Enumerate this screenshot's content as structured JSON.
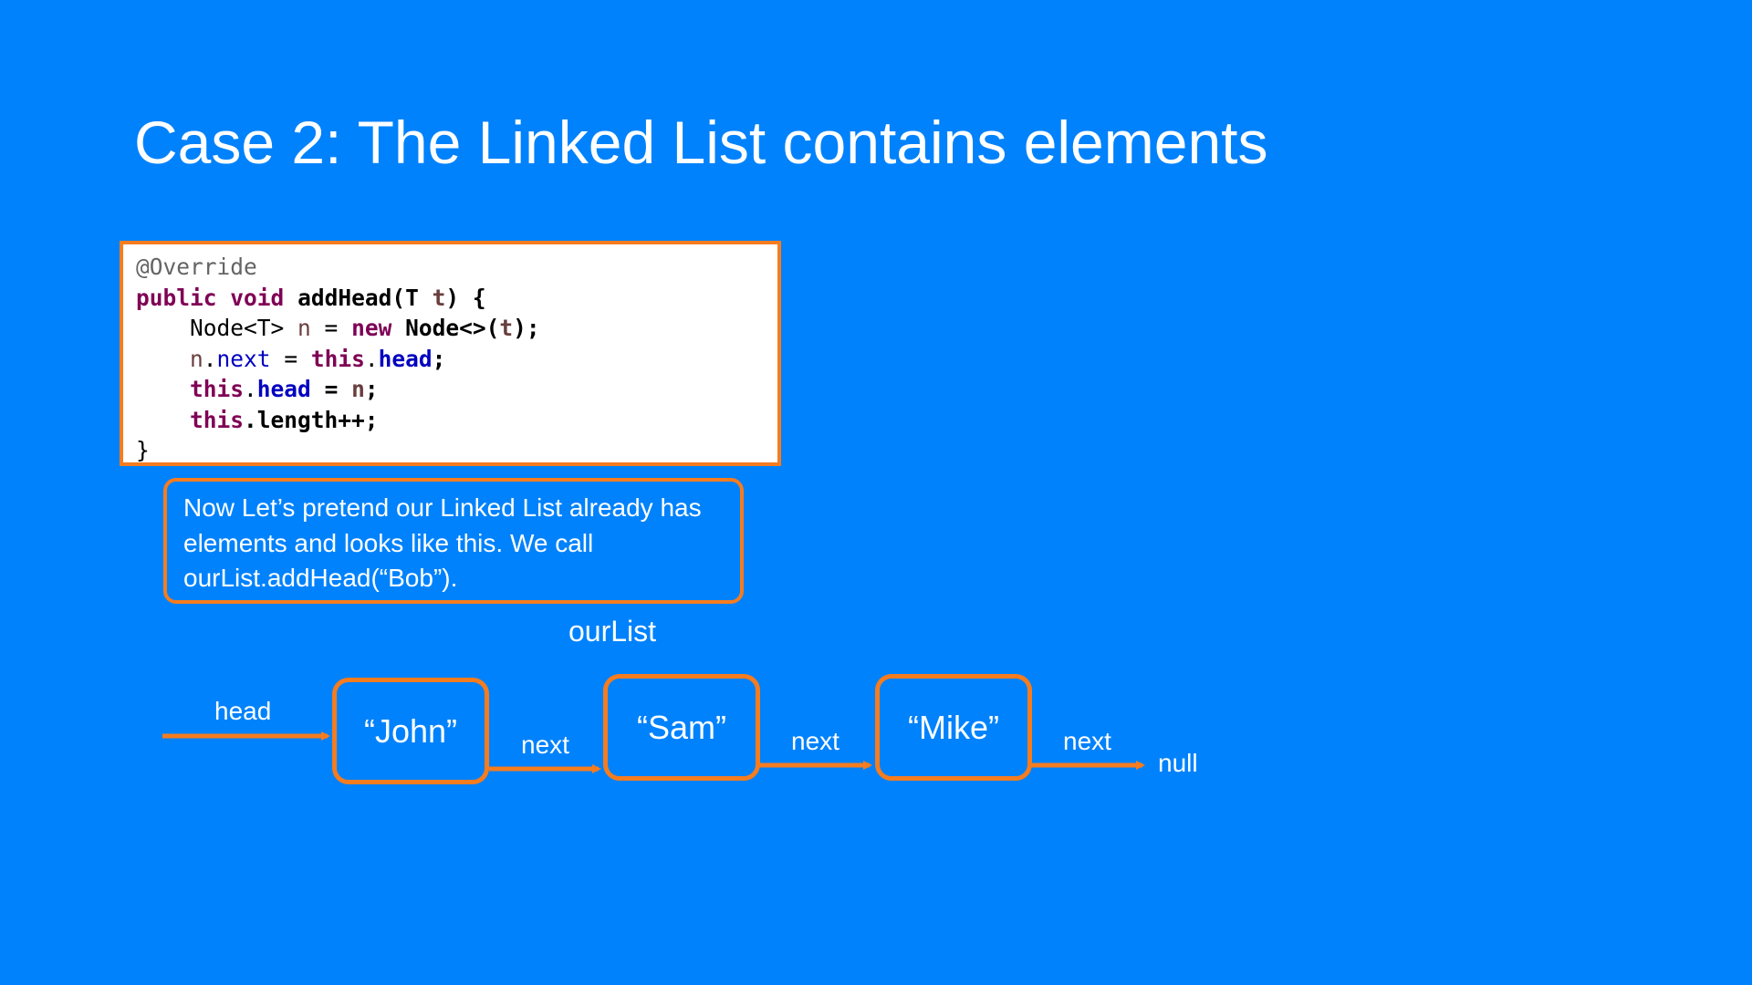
{
  "slide": {
    "title": "Case 2: The Linked List contains elements"
  },
  "code": {
    "annotation": "@Override",
    "kw_public": "public",
    "kw_void": "void",
    "method_sig": "addHead(T ",
    "param_t": "t",
    "sig_end": ") {",
    "l3_type": "Node<T> ",
    "l3_var": "n",
    "l3_eq": " = ",
    "kw_new": "new",
    "l3_ctor": " Node<>(",
    "l3_arg": "t",
    "l3_end": ");",
    "l4_var": "n",
    "l4_dot": ".",
    "l4_field": "next",
    "l4_eq": " = ",
    "kw_this": "this",
    "l4_dot2": ".",
    "l4_head": "head",
    "l4_end": ";",
    "l5_this": "this",
    "l5_dot": ".",
    "l5_head": "head",
    "l5_eq": " = ",
    "l5_var": "n",
    "l5_end": ";",
    "l6_this": "this",
    "l6_rest": ".length++;",
    "close_brace": "}"
  },
  "note": {
    "text": "Now Let’s pretend our Linked List already has elements and looks like this. We call ourList.addHead(“Bob”)."
  },
  "diagram": {
    "list_label": "ourList",
    "head_label": "head",
    "nodes": [
      "“John”",
      "“Sam”",
      "“Mike”"
    ],
    "next_labels": [
      "next",
      "next",
      "next"
    ],
    "null_label": "null",
    "accent_color": "#f57c1f",
    "background_color": "#0082fc"
  }
}
